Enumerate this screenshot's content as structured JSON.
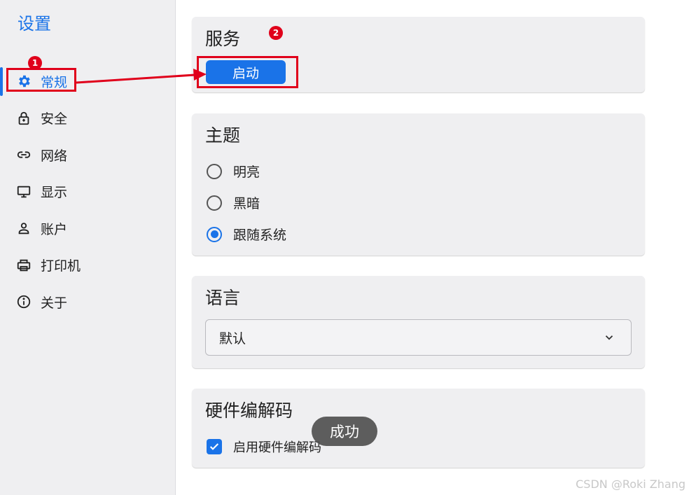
{
  "sidebar": {
    "title": "设置",
    "items": [
      {
        "label": "常规",
        "icon": "gear-icon",
        "active": true
      },
      {
        "label": "安全",
        "icon": "lock-icon",
        "active": false
      },
      {
        "label": "网络",
        "icon": "link-icon",
        "active": false
      },
      {
        "label": "显示",
        "icon": "monitor-icon",
        "active": false
      },
      {
        "label": "账户",
        "icon": "person-icon",
        "active": false
      },
      {
        "label": "打印机",
        "icon": "printer-icon",
        "active": false
      },
      {
        "label": "关于",
        "icon": "info-icon",
        "active": false
      }
    ]
  },
  "service": {
    "title": "服务",
    "start_label": "启动"
  },
  "theme": {
    "title": "主题",
    "options": [
      {
        "label": "明亮",
        "checked": false
      },
      {
        "label": "黑暗",
        "checked": false
      },
      {
        "label": "跟随系统",
        "checked": true
      }
    ]
  },
  "language": {
    "title": "语言",
    "selected": "默认"
  },
  "hardware": {
    "title": "硬件编解码",
    "checkbox_label": "启用硬件编解码",
    "checked": true
  },
  "toast": {
    "text": "成功"
  },
  "annotations": {
    "badge1": "1",
    "badge2": "2"
  },
  "watermark": "CSDN @Roki Zhang",
  "colors": {
    "accent": "#1a73e8",
    "annotation": "#e0001b",
    "sidebar_bg": "#efeff1"
  }
}
